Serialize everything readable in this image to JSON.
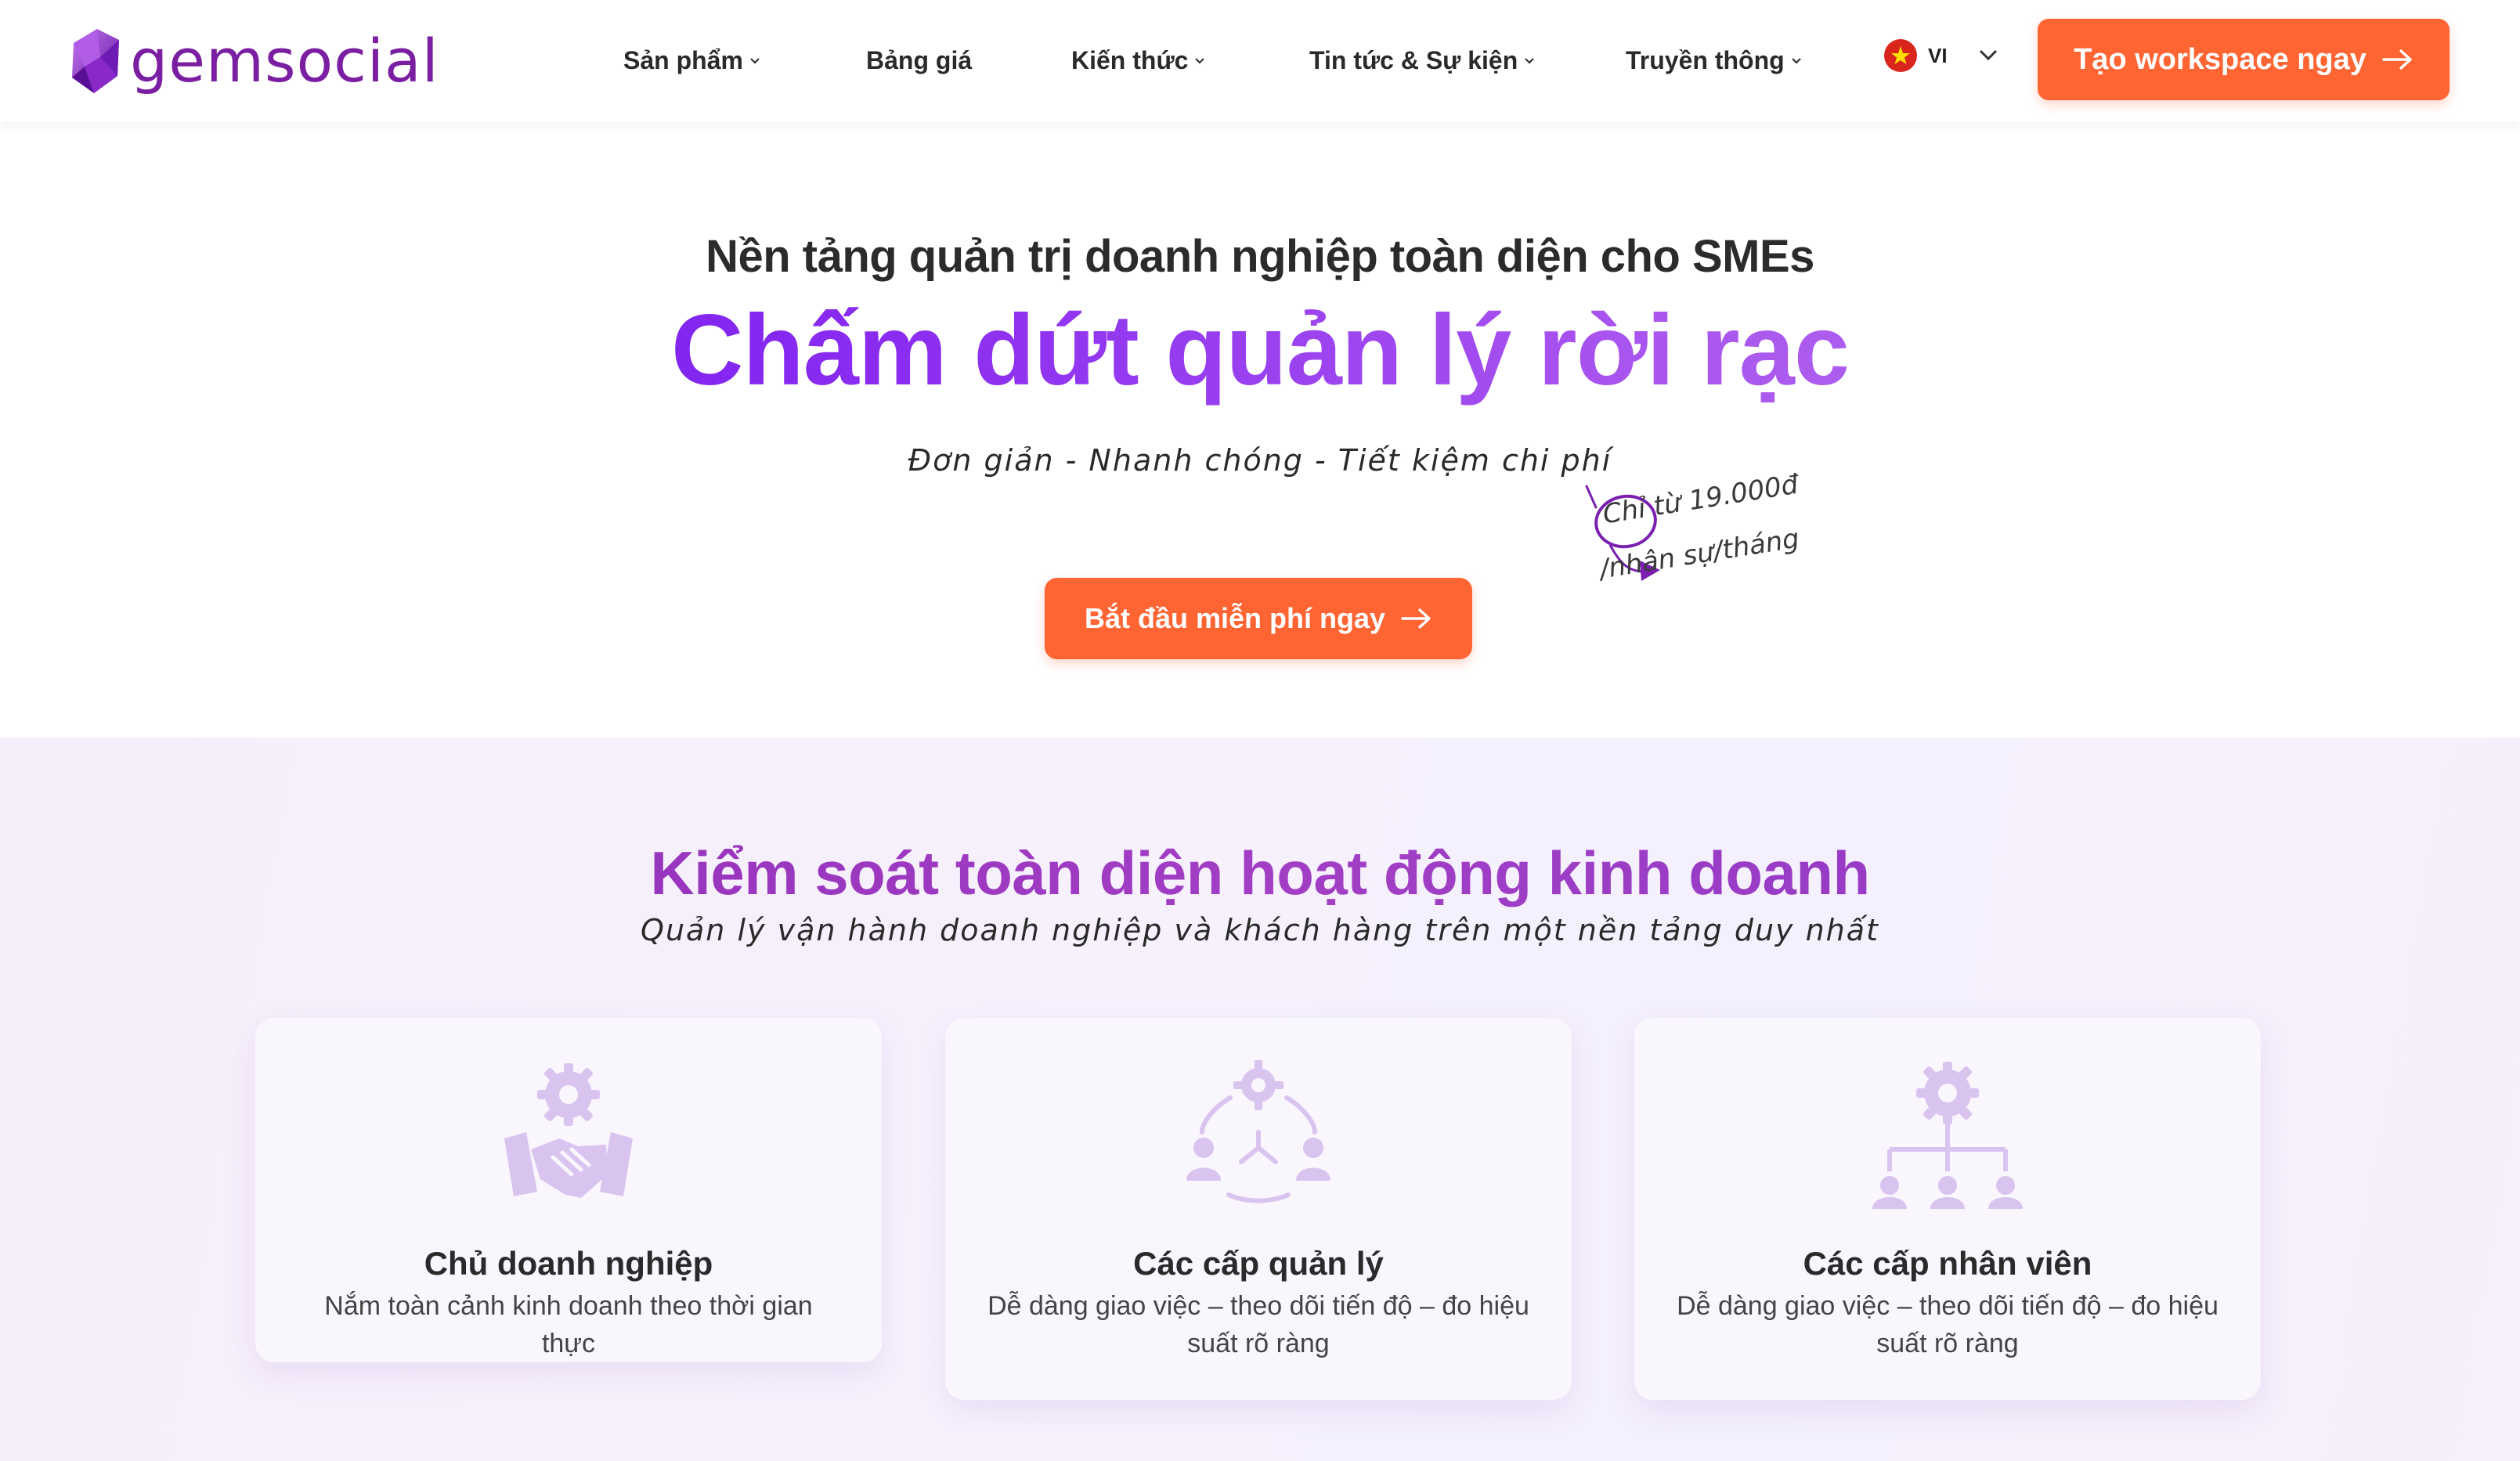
{
  "brand": {
    "name": "gemsocial",
    "color": "#7b1fa2"
  },
  "nav": {
    "items": [
      {
        "label": "Sản phẩm",
        "has_dropdown": true
      },
      {
        "label": "Bảng giá",
        "has_dropdown": false
      },
      {
        "label": "Kiến thức",
        "has_dropdown": true
      },
      {
        "label": "Tin tức & Sự kiện",
        "has_dropdown": true
      },
      {
        "label": "Truyền thông",
        "has_dropdown": true
      }
    ],
    "language": {
      "code": "VI",
      "flag": "vietnam-flag-icon"
    },
    "cta_label": "Tạo workspace ngay"
  },
  "hero": {
    "subtitle": "Nền tảng quản trị doanh nghiệp toàn diện cho SMEs",
    "title": "Chấm dứt quản lý rời rạc",
    "tagline": "Đơn giản - Nhanh chóng - Tiết kiệm chi phí",
    "price_line1": "Chỉ từ 19.000đ",
    "price_line2": "/nhân sự/tháng",
    "cta_label": "Bắt đầu miễn phí ngay"
  },
  "section": {
    "title": "Kiểm soát toàn diện hoạt động kinh doanh",
    "subtitle": "Quản lý vận hành doanh nghiệp và khách hàng trên một nền tảng duy nhất",
    "cards": [
      {
        "icon": "handshake-gear-icon",
        "title": "Chủ doanh nghiệp",
        "desc": "Nắm toàn cảnh kinh doanh theo thời gian thực"
      },
      {
        "icon": "management-cycle-icon",
        "title": "Các cấp quản lý",
        "desc": "Dễ dàng giao việc – theo dõi tiến độ – đo hiệu suất rõ ràng"
      },
      {
        "icon": "org-chart-icon",
        "title": "Các cấp nhân viên",
        "desc": "Dễ dàng giao việc – theo dõi tiến độ – đo hiệu suất rõ ràng"
      }
    ]
  },
  "colors": {
    "accent": "#ff6433",
    "title_gradient_start": "#6a10f0",
    "title_gradient_end": "#b676ec",
    "section_title": "#9a36bf",
    "icon_fill": "#d7c3ee"
  }
}
